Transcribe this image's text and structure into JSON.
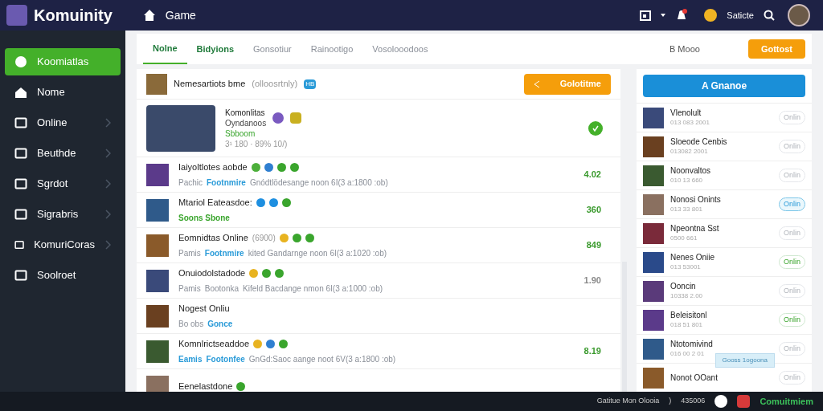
{
  "topbar": {
    "brand": "Komuinity",
    "nav": "Game",
    "user": "Saticte"
  },
  "sidebar": {
    "items": [
      {
        "label": "Koomiatlas",
        "selected": true,
        "expandable": false
      },
      {
        "label": "Nome",
        "selected": false,
        "expandable": false
      },
      {
        "label": "Online",
        "selected": false,
        "expandable": true
      },
      {
        "label": "Beuthde",
        "selected": false,
        "expandable": true
      },
      {
        "label": "Sgrdot",
        "selected": false,
        "expandable": true
      },
      {
        "label": "Sigrabris",
        "selected": false,
        "expandable": true
      },
      {
        "label": "KomuriCoras",
        "selected": false,
        "expandable": true
      },
      {
        "label": "Soolroet",
        "selected": false,
        "expandable": false
      }
    ]
  },
  "tabs": [
    {
      "label": "Nolne",
      "selected": true,
      "kind": "accent"
    },
    {
      "label": "Bidyions",
      "selected": false,
      "kind": "accent"
    },
    {
      "label": "Gonsotiur",
      "selected": false,
      "kind": "plain"
    },
    {
      "label": "Rainootigo",
      "selected": false,
      "kind": "plain"
    },
    {
      "label": "Vosolooodoos",
      "selected": false,
      "kind": "plain"
    }
  ],
  "tabs_right": {
    "label": "B Mooo",
    "button": "Gottost"
  },
  "feed": {
    "title": "Nemesartiots bme",
    "title_note": "(olloosrtnly)",
    "badge": "HB",
    "button": "Golotitme",
    "featured": {
      "title": "Komonlitas",
      "subtitle": "Oyndanoos",
      "tag": "Sbboom",
      "meta": "3¹ 180 · 89% 10/)",
      "checked": true
    },
    "rows": [
      {
        "title": "Iaiyoltlotes aobde",
        "badges": [
          {
            "color": "#4caf3a"
          },
          {
            "color": "#2f7fd0"
          },
          {
            "color": "#3aa52d"
          },
          {
            "color": "#3aa52d"
          }
        ],
        "parts": [
          {
            "text": "Pachic",
            "kind": "muted"
          },
          {
            "text": "Footnmire",
            "kind": "link"
          },
          {
            "text": "Gnódtlödesange noon 6I(3 a:1800 :ob)",
            "kind": "muted"
          }
        ],
        "value": "4.02",
        "color": "#3a9a2d"
      },
      {
        "title": "Mtariol Eateasdoe:",
        "badges": [
          {
            "color": "#1e8fe0"
          },
          {
            "color": "#1e8fe0"
          },
          {
            "color": "#3aa52d"
          }
        ],
        "parts": [
          {
            "text": "Soons Sbone",
            "kind": "green"
          }
        ],
        "value": "360",
        "color": "#3a9a2d"
      },
      {
        "title": "Eomnidtas Online",
        "note": "(6900)",
        "badges": [
          {
            "color": "#e8b320"
          },
          {
            "color": "#3aa52d"
          },
          {
            "color": "#3aa52d"
          }
        ],
        "parts": [
          {
            "text": "Pamis",
            "kind": "muted"
          },
          {
            "text": "Footnmire",
            "kind": "link"
          },
          {
            "text": "kited Gandarnge noon 6I(3 a:1020 :ob)",
            "kind": "muted"
          }
        ],
        "value": "849",
        "color": "#3a9a2d"
      },
      {
        "title": "Onuiodolstadode",
        "badges": [
          {
            "color": "#e8b320"
          },
          {
            "color": "#3aa52d"
          },
          {
            "color": "#3aa52d"
          }
        ],
        "parts": [
          {
            "text": "Pamis",
            "kind": "muted"
          },
          {
            "text": "Bootonka",
            "kind": "muted"
          },
          {
            "text": "Kifeld Bacdange nmon 6I(3 a:1000 :ob)",
            "kind": "muted"
          }
        ],
        "value": "1.90",
        "color": "#8a8a8a"
      },
      {
        "title": "Nogest Onliu",
        "parts": [
          {
            "text": "Bo obs",
            "kind": "muted"
          },
          {
            "text": "Gonce",
            "kind": "link"
          }
        ]
      },
      {
        "title": "Komnlrictseaddoe",
        "badges": [
          {
            "color": "#e8b320"
          },
          {
            "color": "#2f7fd0"
          },
          {
            "color": "#3aa52d"
          }
        ],
        "parts": [
          {
            "text": "Eamis",
            "kind": "link"
          },
          {
            "text": "Footonfee",
            "kind": "link"
          },
          {
            "text": "GnGd:Saoc aange noot 6V(3 a:1800 :ob)",
            "kind": "muted"
          }
        ],
        "value": "8.19",
        "color": "#3a9a2d"
      },
      {
        "title": "Eenelastdone",
        "badges": [
          {
            "color": "#3aa52d"
          }
        ]
      }
    ]
  },
  "side": {
    "button": "A Gnanoe",
    "tooltip": "Gooss 1ogoona",
    "items": [
      {
        "name": "Vlenolult",
        "sub": "013 083 2001",
        "status": "Onlin",
        "kind": "plain"
      },
      {
        "name": "Sloeode Cenbis",
        "sub": "013082 2001",
        "status": "Onlin",
        "kind": "plain"
      },
      {
        "name": "Noonvaltos",
        "sub": "010 13 660",
        "status": "Onlin",
        "kind": "plain"
      },
      {
        "name": "Nonosi Onints",
        "sub": "013 33 801",
        "status": "Onlin",
        "kind": "blue"
      },
      {
        "name": "Npeontna Sst",
        "sub": "0500 661",
        "status": "Onlin",
        "kind": "plain"
      },
      {
        "name": "Nenes Oniie",
        "sub": "013 53001",
        "status": "Onlin",
        "kind": "green"
      },
      {
        "name": "Ooncin",
        "sub": "10338 2.00",
        "status": "Onlin",
        "kind": "plain"
      },
      {
        "name": "Beleisitonl",
        "sub": "018 51 801",
        "status": "Onlin",
        "kind": "green"
      },
      {
        "name": "Ntotomivind",
        "sub": "016 00 2 01",
        "status": "Onlin",
        "kind": "plain"
      },
      {
        "name": "Nonot OOant",
        "status": "Onlin",
        "kind": "plain"
      }
    ]
  },
  "footer": {
    "text": "Gatitue Mon Olooia",
    "separator": ")",
    "code": "435006",
    "brand": "Comuitmiem"
  }
}
